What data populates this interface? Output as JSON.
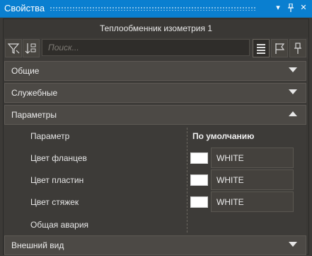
{
  "window": {
    "title": "Свойства",
    "dropdown_glyph": "▾",
    "pin_glyph": "📌",
    "close_glyph": "✕"
  },
  "object_title": "Теплообменник изометрия 1",
  "toolbar": {
    "filter_icon": "filter-icon",
    "sort_icon": "sort-icon",
    "search_placeholder": "Поиск...",
    "view_list_icon": "list-view-icon",
    "flag_icon": "flag-icon",
    "pin_icon": "pin-icon"
  },
  "sections": [
    {
      "label": "Общие",
      "expanded": false
    },
    {
      "label": "Служебные",
      "expanded": false
    },
    {
      "label": "Параметры",
      "expanded": true
    },
    {
      "label": "Внешний вид",
      "expanded": false
    }
  ],
  "parameters": {
    "column_name": "Параметр",
    "column_default": "По умолчанию",
    "rows": [
      {
        "name": "Цвет фланцев",
        "value": "WHITE",
        "color": "#ffffff"
      },
      {
        "name": "Цвет пластин",
        "value": "WHITE",
        "color": "#ffffff"
      },
      {
        "name": "Цвет стяжек",
        "value": "WHITE",
        "color": "#ffffff"
      },
      {
        "name": "Общая авария",
        "value": ""
      }
    ]
  },
  "colors": {
    "accent": "#0a7fd0",
    "background": "#3c3a37",
    "section": "#4c4945"
  }
}
